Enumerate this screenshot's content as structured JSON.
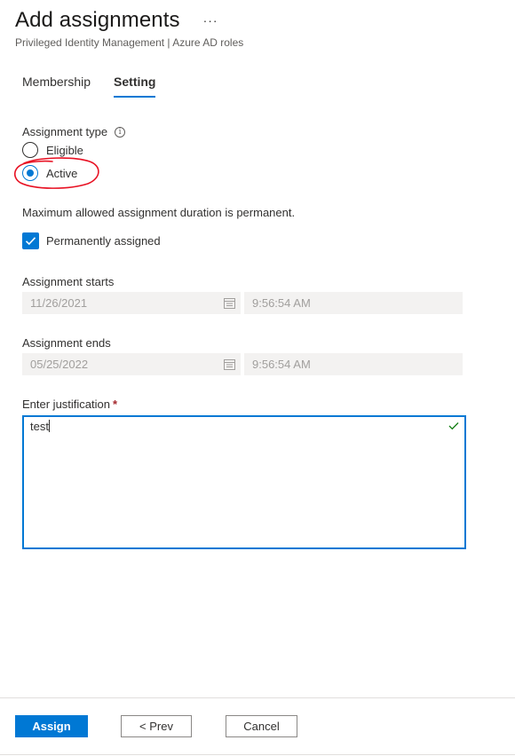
{
  "header": {
    "title": "Add assignments",
    "more_label": "···",
    "subtitle": "Privileged Identity Management | Azure AD roles"
  },
  "tabs": [
    {
      "label": "Membership",
      "active": false
    },
    {
      "label": "Setting",
      "active": true
    }
  ],
  "assignment_type": {
    "label": "Assignment type",
    "info_icon": "info-icon",
    "options": [
      {
        "label": "Eligible",
        "checked": false
      },
      {
        "label": "Active",
        "checked": true
      }
    ]
  },
  "duration_note": "Maximum allowed assignment duration is permanent.",
  "permanent_checkbox": {
    "label": "Permanently assigned",
    "checked": true
  },
  "assignment_starts": {
    "label": "Assignment starts",
    "date": "11/26/2021",
    "time": "9:56:54 AM"
  },
  "assignment_ends": {
    "label": "Assignment ends",
    "date": "05/25/2022",
    "time": "9:56:54 AM"
  },
  "justification": {
    "label": "Enter justification",
    "required_marker": "*",
    "value": "test",
    "valid_icon": "checkmark-icon"
  },
  "footer": {
    "assign_label": "Assign",
    "prev_label": "< Prev",
    "cancel_label": "Cancel"
  },
  "colors": {
    "accent": "#0078d4",
    "annotation": "#e81123",
    "disabled_bg": "#f3f2f1",
    "required": "#a4262c"
  }
}
